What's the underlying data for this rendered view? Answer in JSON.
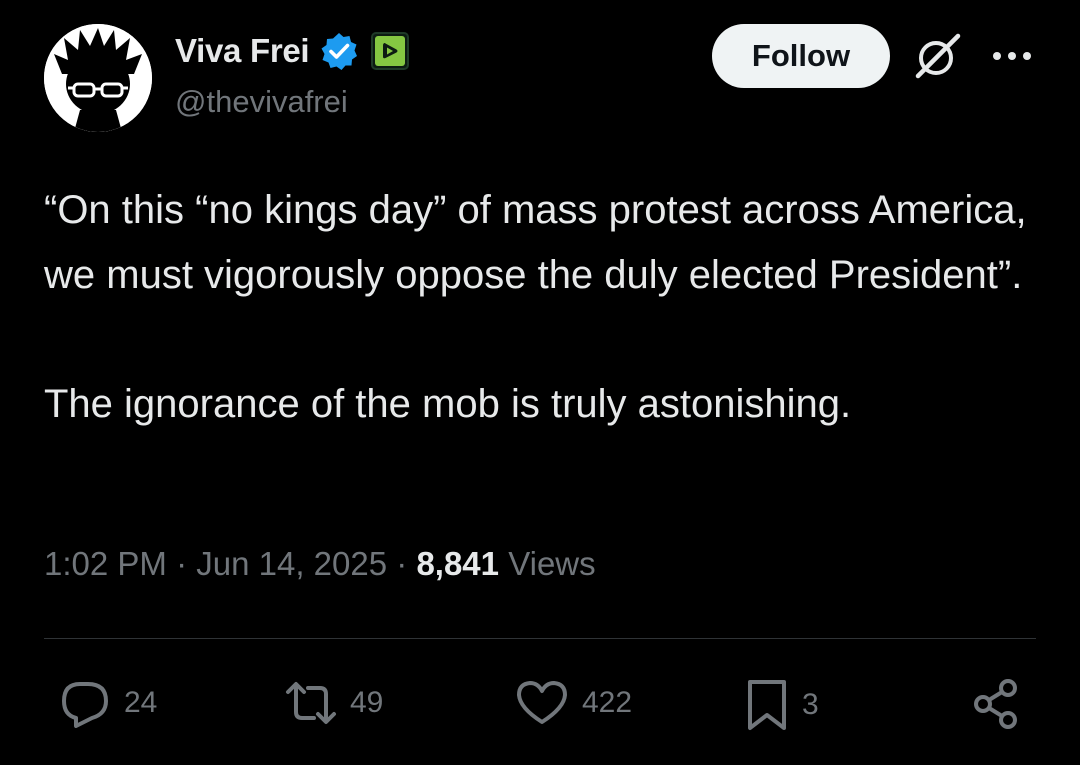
{
  "author": {
    "display_name": "Viva Frei",
    "handle": "@thevivafrei",
    "verified_icon": "verified-badge-icon",
    "affiliate_icon": "rumble-logo-icon",
    "avatar_icon": "avatar-cartoon-glasses"
  },
  "header": {
    "follow_label": "Follow",
    "grok_icon": "grok-icon",
    "more_icon": "more-icon"
  },
  "tweet": {
    "text": "“On this “no kings day” of mass protest across America, we must vigorously oppose the duly elected President”.\n\nThe ignorance of the mob is truly astonishing.",
    "time": "1:02 PM",
    "separator": "·",
    "date": "Jun 14, 2025",
    "views_count": "8,841",
    "views_label": "Views"
  },
  "actions": {
    "replies": "24",
    "reposts": "49",
    "likes": "422",
    "bookmarks": "3",
    "share_icon": "share-icon"
  },
  "colors": {
    "background": "#000000",
    "text": "#e7e9ea",
    "muted": "#71767b",
    "verified": "#1d9bf0",
    "rumble": "#85c742",
    "divider": "#2f3336"
  }
}
